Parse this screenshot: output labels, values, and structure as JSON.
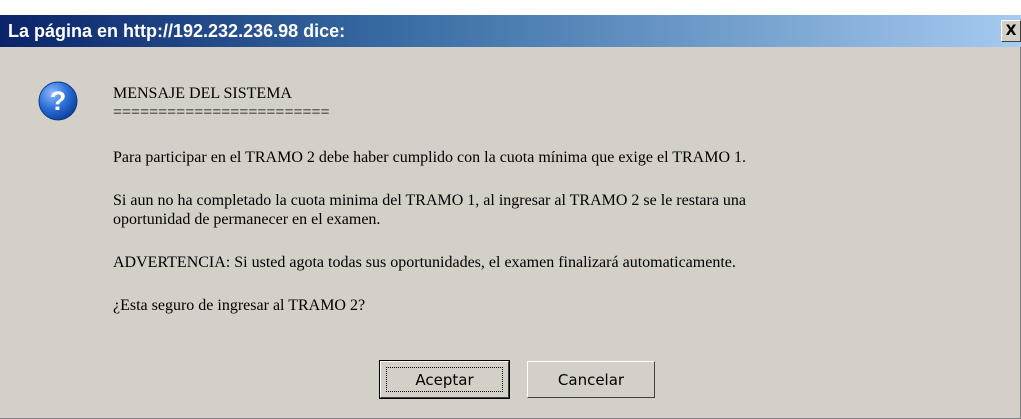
{
  "dialog": {
    "title": "La página en http://192.232.236.98 dice:",
    "close_symbol": "X",
    "icon": "question-icon",
    "message": {
      "title": "MENSAJE DEL SISTEMA",
      "separator": "========================",
      "paragraph1": "Para participar en el TRAMO 2 debe haber cumplido con la cuota mínima que exige el TRAMO 1.",
      "paragraph2_line1": "Si aun no ha completado la cuota minima del TRAMO 1, al ingresar al TRAMO 2 se le restara una",
      "paragraph2_line2": "oportunidad de permanecer en el examen.",
      "paragraph3": "ADVERTENCIA: Si usted agota todas sus oportunidades, el examen finalizará automaticamente.",
      "question": "¿Esta seguro de ingresar al TRAMO 2?"
    },
    "buttons": {
      "accept": "Aceptar",
      "cancel": "Cancelar"
    },
    "colors": {
      "title_gradient_start": "#0a246a",
      "title_gradient_end": "#a6caf0",
      "dialog_face": "#d4d0c8",
      "icon_blue": "#1f5fbf"
    }
  }
}
